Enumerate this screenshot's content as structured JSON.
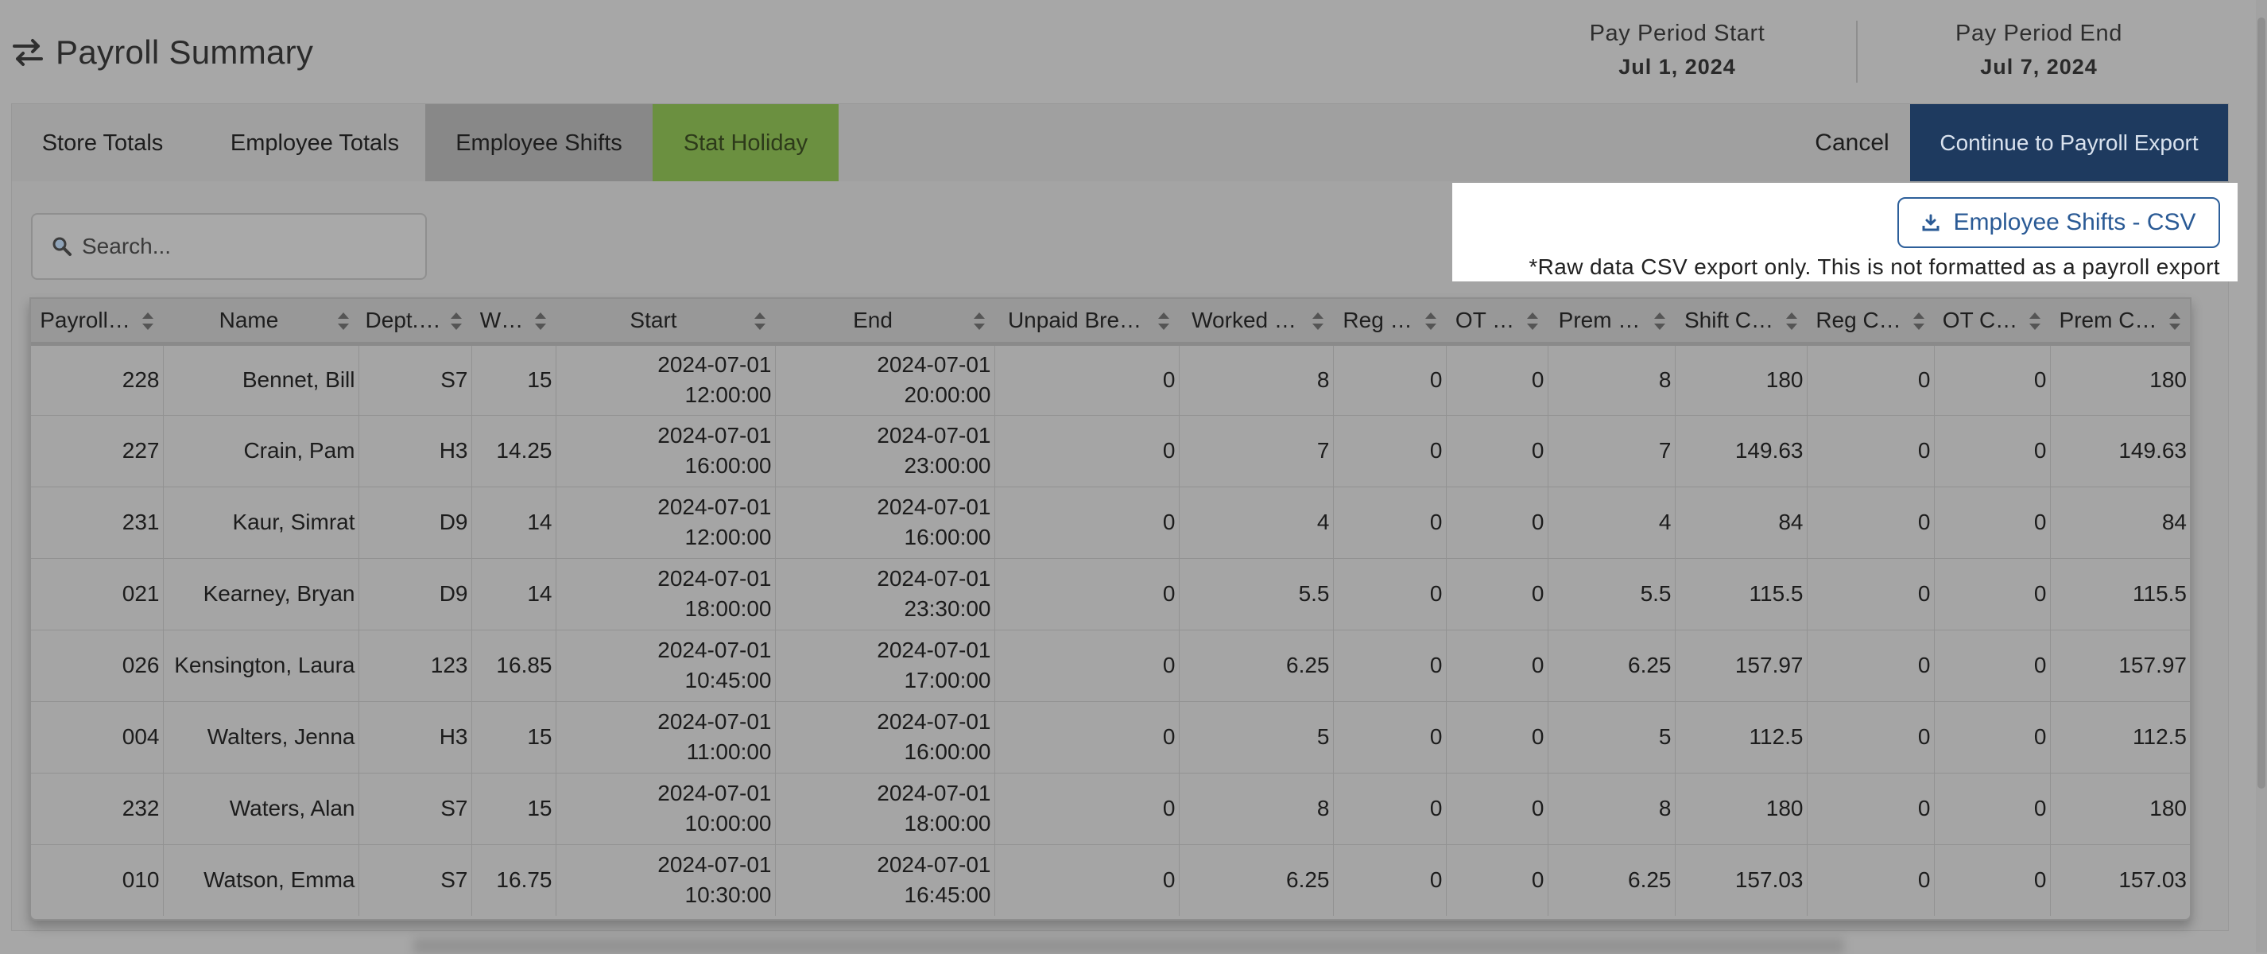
{
  "header": {
    "title": "Payroll Summary",
    "pay_period_start_label": "Pay Period Start",
    "pay_period_start_value": "Jul 1, 2024",
    "pay_period_end_label": "Pay Period End",
    "pay_period_end_value": "Jul 7, 2024"
  },
  "tabs": [
    {
      "label": "Store Totals"
    },
    {
      "label": "Employee Totals"
    },
    {
      "label": "Employee Shifts",
      "active": true
    },
    {
      "label": "Stat Holiday"
    }
  ],
  "actions": {
    "cancel_label": "Cancel",
    "continue_label": "Continue to Payroll Export"
  },
  "search": {
    "placeholder": "Search..."
  },
  "export": {
    "csv_button_label": "Employee Shifts - CSV",
    "note": "*Raw data CSV export only. This is not formatted as a payroll export"
  },
  "table": {
    "columns": [
      "Payroll…",
      "Name",
      "Dept.…",
      "W…",
      "Start",
      "End",
      "Unpaid Bre…",
      "Worked …",
      "Reg …",
      "OT …",
      "Prem …",
      "Shift C…",
      "Reg C…",
      "OT C…",
      "Prem C…"
    ],
    "rows": [
      {
        "payroll": "228",
        "name": "Bennet, Bill",
        "dept": "S7",
        "wage": "15",
        "start_date": "2024-07-01",
        "start_time": "12:00:00",
        "end_date": "2024-07-01",
        "end_time": "20:00:00",
        "unpaid": "0",
        "worked": "8",
        "reg": "0",
        "ot": "0",
        "prem": "8",
        "shift_cost": "180",
        "reg_cost": "0",
        "ot_cost": "0",
        "prem_cost": "180"
      },
      {
        "payroll": "227",
        "name": "Crain, Pam",
        "dept": "H3",
        "wage": "14.25",
        "start_date": "2024-07-01",
        "start_time": "16:00:00",
        "end_date": "2024-07-01",
        "end_time": "23:00:00",
        "unpaid": "0",
        "worked": "7",
        "reg": "0",
        "ot": "0",
        "prem": "7",
        "shift_cost": "149.63",
        "reg_cost": "0",
        "ot_cost": "0",
        "prem_cost": "149.63"
      },
      {
        "payroll": "231",
        "name": "Kaur, Simrat",
        "dept": "D9",
        "wage": "14",
        "start_date": "2024-07-01",
        "start_time": "12:00:00",
        "end_date": "2024-07-01",
        "end_time": "16:00:00",
        "unpaid": "0",
        "worked": "4",
        "reg": "0",
        "ot": "0",
        "prem": "4",
        "shift_cost": "84",
        "reg_cost": "0",
        "ot_cost": "0",
        "prem_cost": "84"
      },
      {
        "payroll": "021",
        "name": "Kearney, Bryan",
        "dept": "D9",
        "wage": "14",
        "start_date": "2024-07-01",
        "start_time": "18:00:00",
        "end_date": "2024-07-01",
        "end_time": "23:30:00",
        "unpaid": "0",
        "worked": "5.5",
        "reg": "0",
        "ot": "0",
        "prem": "5.5",
        "shift_cost": "115.5",
        "reg_cost": "0",
        "ot_cost": "0",
        "prem_cost": "115.5"
      },
      {
        "payroll": "026",
        "name": "Kensington, Laura",
        "dept": "123",
        "wage": "16.85",
        "start_date": "2024-07-01",
        "start_time": "10:45:00",
        "end_date": "2024-07-01",
        "end_time": "17:00:00",
        "unpaid": "0",
        "worked": "6.25",
        "reg": "0",
        "ot": "0",
        "prem": "6.25",
        "shift_cost": "157.97",
        "reg_cost": "0",
        "ot_cost": "0",
        "prem_cost": "157.97"
      },
      {
        "payroll": "004",
        "name": "Walters, Jenna",
        "dept": "H3",
        "wage": "15",
        "start_date": "2024-07-01",
        "start_time": "11:00:00",
        "end_date": "2024-07-01",
        "end_time": "16:00:00",
        "unpaid": "0",
        "worked": "5",
        "reg": "0",
        "ot": "0",
        "prem": "5",
        "shift_cost": "112.5",
        "reg_cost": "0",
        "ot_cost": "0",
        "prem_cost": "112.5"
      },
      {
        "payroll": "232",
        "name": "Waters, Alan",
        "dept": "S7",
        "wage": "15",
        "start_date": "2024-07-01",
        "start_time": "10:00:00",
        "end_date": "2024-07-01",
        "end_time": "18:00:00",
        "unpaid": "0",
        "worked": "8",
        "reg": "0",
        "ot": "0",
        "prem": "8",
        "shift_cost": "180",
        "reg_cost": "0",
        "ot_cost": "0",
        "prem_cost": "180"
      },
      {
        "payroll": "010",
        "name": "Watson, Emma",
        "dept": "S7",
        "wage": "16.75",
        "start_date": "2024-07-01",
        "start_time": "10:30:00",
        "end_date": "2024-07-01",
        "end_time": "16:45:00",
        "unpaid": "0",
        "worked": "6.25",
        "reg": "0",
        "ot": "0",
        "prem": "6.25",
        "shift_cost": "157.03",
        "reg_cost": "0",
        "ot_cost": "0",
        "prem_cost": "157.03"
      }
    ]
  },
  "colors": {
    "active_tab": "#888888",
    "stat_holiday_tab": "#6b9040",
    "primary_button": "#1e3a5f",
    "csv_button_border": "#2d5f9a"
  },
  "icons": {
    "title": "swap-arrows-icon",
    "search": "search-icon",
    "csv": "download-icon",
    "sort": "sort-icon"
  }
}
